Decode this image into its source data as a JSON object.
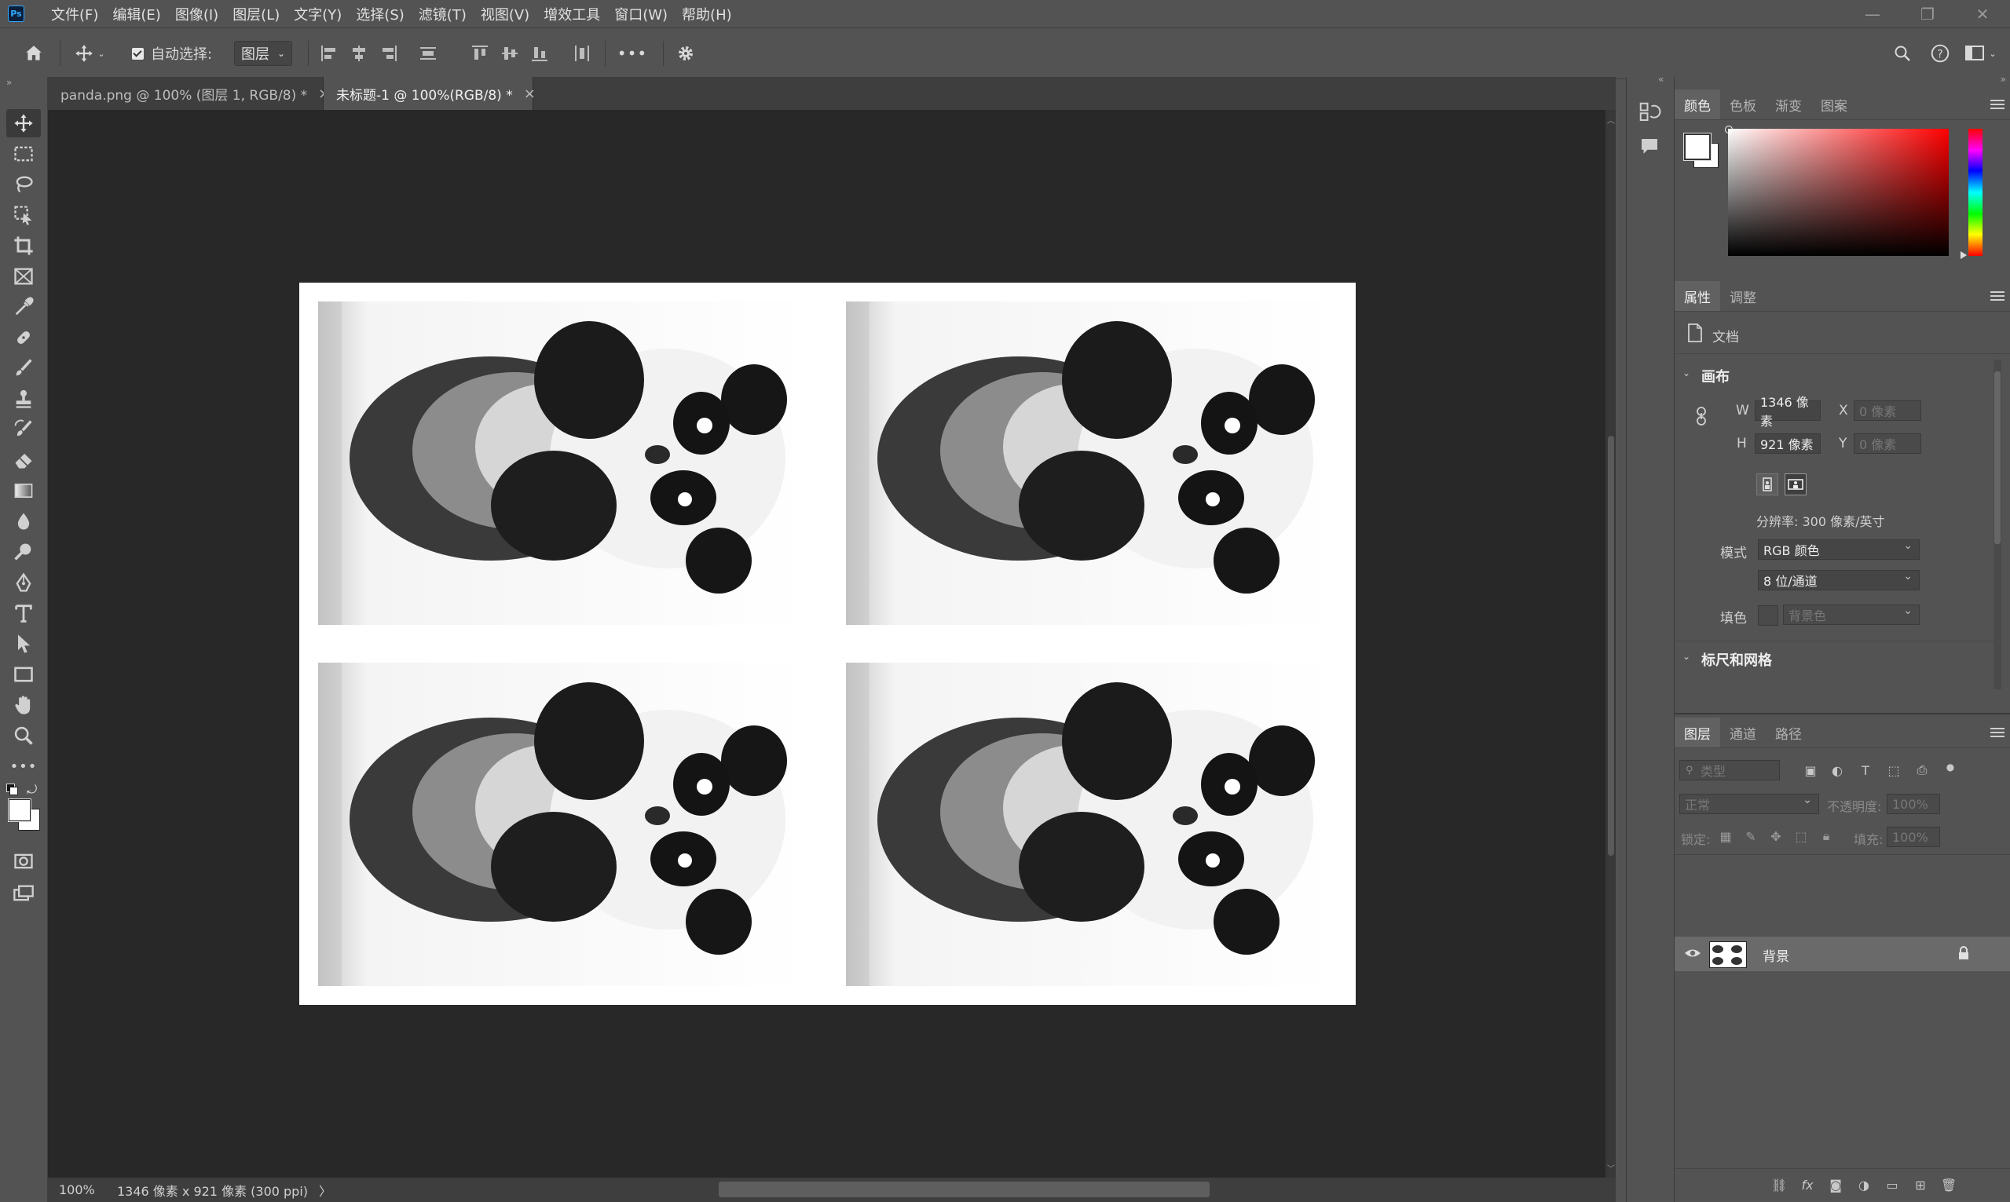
{
  "menu": {
    "items": [
      "文件(F)",
      "编辑(E)",
      "图像(I)",
      "图层(L)",
      "文字(Y)",
      "选择(S)",
      "滤镜(T)",
      "视图(V)",
      "增效工具",
      "窗口(W)",
      "帮助(H)"
    ],
    "logo_text": "Ps"
  },
  "options": {
    "auto_select_label": "自动选择:",
    "auto_select_target": "图层",
    "more_label": "•••"
  },
  "tabs": [
    {
      "label": "panda.png @ 100% (图层 1, RGB/8) *",
      "close": "×"
    },
    {
      "label": "未标题-1 @ 100%(RGB/8) *",
      "close": "×"
    }
  ],
  "status": {
    "zoom": "100%",
    "info": "1346 像素 x 921 像素 (300 ppi)",
    "arrow": "〉"
  },
  "color_panel": {
    "tabs": [
      "颜色",
      "色板",
      "渐变",
      "图案"
    ]
  },
  "properties_panel": {
    "tabs": [
      "属性",
      "调整"
    ],
    "doc_label": "文档",
    "canvas_header": "画布",
    "w_label": "W",
    "w_value": "1346 像素",
    "h_label": "H",
    "h_value": "921 像素",
    "x_label": "X",
    "x_placeholder": "0 像素",
    "y_label": "Y",
    "y_placeholder": "0 像素",
    "resolution": "分辨率: 300 像素/英寸",
    "mode_label": "模式",
    "mode_value": "RGB 颜色",
    "depth_value": "8 位/通道",
    "fill_label": "填色",
    "fill_value": "背景色",
    "rulers_header": "标尺和网格"
  },
  "layers_panel": {
    "tabs": [
      "图层",
      "通道",
      "路径"
    ],
    "search_placeholder": "类型",
    "blend_mode": "正常",
    "opacity_label": "不透明度:",
    "opacity_value": "100%",
    "lock_label": "锁定:",
    "fill_label": "填充:",
    "fill_value": "100%",
    "layers": [
      {
        "name": "背景",
        "visible": true,
        "locked": true
      }
    ]
  },
  "colors": {
    "ui_bg": "#535353",
    "canvas_bg": "#282828",
    "accent": "#31a8ff"
  }
}
